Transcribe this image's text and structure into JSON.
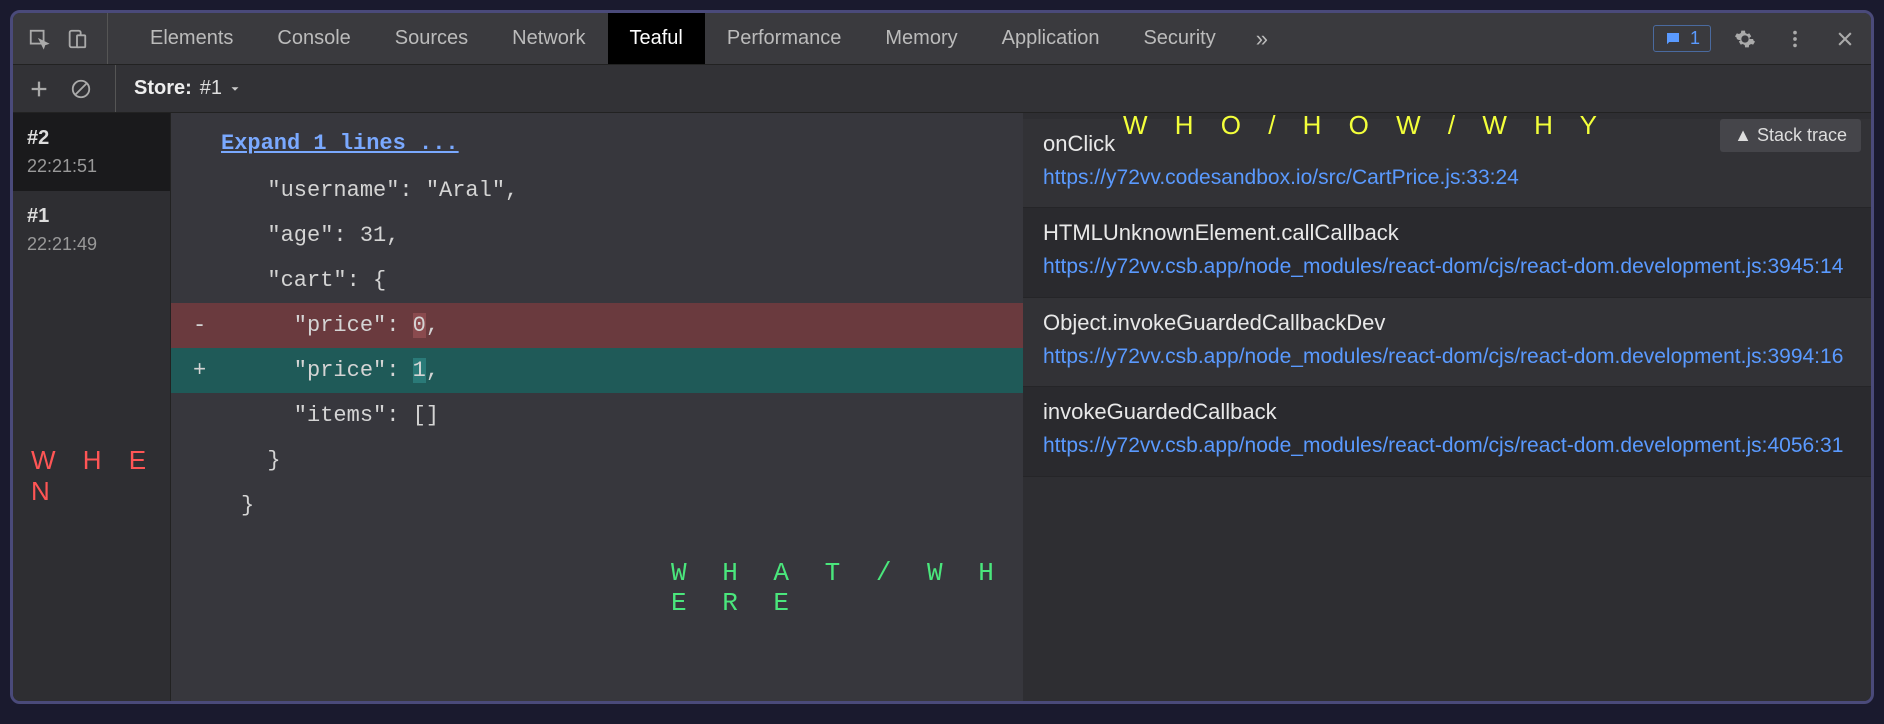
{
  "devtools": {
    "tabs": [
      "Elements",
      "Console",
      "Sources",
      "Network",
      "Teaful",
      "Performance",
      "Memory",
      "Application",
      "Security"
    ],
    "active_tab_index": 4,
    "message_badge_count": "1"
  },
  "toolbar": {
    "store_label": "Store:",
    "store_value": "#1"
  },
  "history": [
    {
      "id": "#2",
      "time": "22:21:51",
      "active": true
    },
    {
      "id": "#1",
      "time": "22:21:49",
      "active": false
    }
  ],
  "diff": {
    "expand_label": "Expand 1 lines ...",
    "lines": [
      {
        "type": "ctx",
        "text": "  \"username\": \"Aral\","
      },
      {
        "type": "ctx",
        "text": "  \"age\": 31,"
      },
      {
        "type": "ctx",
        "text": "  \"cart\": {"
      },
      {
        "type": "removed",
        "text": "    \"price\": ",
        "hl": "0",
        "tail": ","
      },
      {
        "type": "added",
        "text": "    \"price\": ",
        "hl": "1",
        "tail": ","
      },
      {
        "type": "ctx",
        "text": "    \"items\": []"
      },
      {
        "type": "ctx",
        "text": "  }"
      },
      {
        "type": "ctx",
        "text": "}"
      }
    ]
  },
  "stack": {
    "button_label": "▲ Stack trace",
    "items": [
      {
        "fn": "onClick",
        "url": "https://y72vv.codesandbox.io/src/CartPrice.js:33:24"
      },
      {
        "fn": "HTMLUnknownElement.callCallback",
        "url": "https://y72vv.csb.app/node_modules/react-dom/cjs/react-dom.development.js:3945:14"
      },
      {
        "fn": "Object.invokeGuardedCallbackDev",
        "url": "https://y72vv.csb.app/node_modules/react-dom/cjs/react-dom.development.js:3994:16"
      },
      {
        "fn": "invokeGuardedCallback",
        "url": "https://y72vv.csb.app/node_modules/react-dom/cjs/react-dom.development.js:4056:31"
      }
    ]
  },
  "annotations": {
    "when": "W H E N",
    "what_where": "W H A T   /   W H E R E",
    "who_how_why": "W H O   /   H O W   /   W H Y"
  }
}
